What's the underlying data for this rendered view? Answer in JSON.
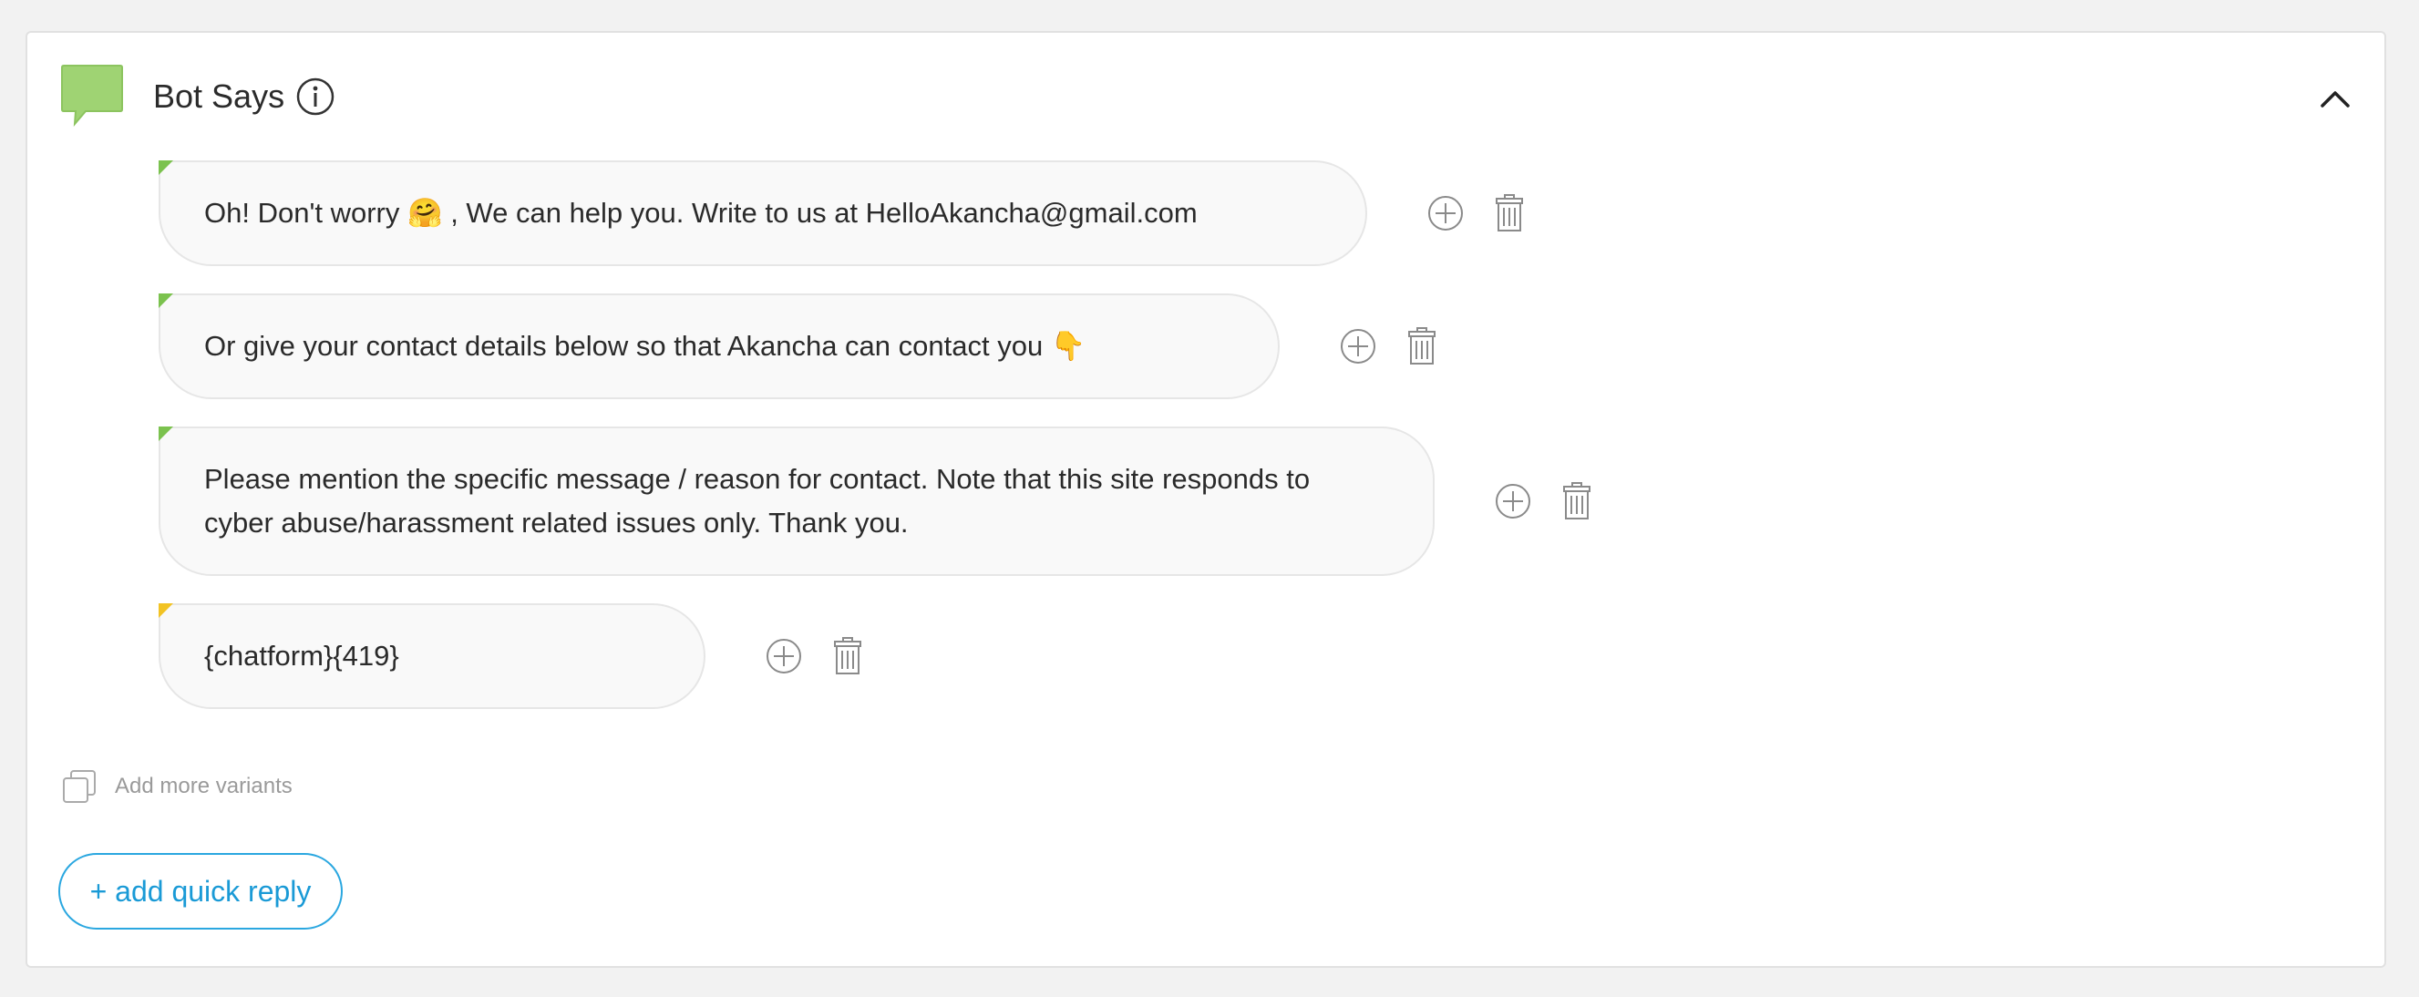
{
  "section": {
    "title": "Bot Says",
    "icon": "speech-bubble-icon",
    "accent_color": "#8fcf5f"
  },
  "messages": [
    {
      "text": "Oh! Don't worry 🤗 , We can help you. Write to us at HelloAkancha@gmail.com",
      "marker_color": "#7bc24e"
    },
    {
      "text": "Or give your contact details below so that Akancha can contact you 👇",
      "marker_color": "#7bc24e"
    },
    {
      "text": "Please mention the specific message / reason for contact. Note that this site responds to cyber abuse/harassment related issues only. Thank you.",
      "marker_color": "#7bc24e"
    },
    {
      "text": "{chatform}{419}",
      "marker_color": "#f2c324"
    }
  ],
  "variants": {
    "label": "Add more variants"
  },
  "quick_reply": {
    "label": "+ add quick reply",
    "color": "#1a9ad6"
  }
}
